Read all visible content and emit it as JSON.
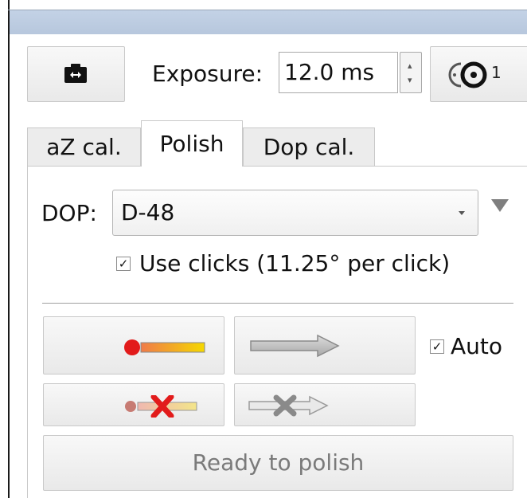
{
  "toolbar": {
    "camera_icon": "camera-swap-icon",
    "exposure_label": "Exposure:",
    "exposure_value": "12.0 ms",
    "channel_icon": "polarization-channel-icon",
    "channel_number": "1"
  },
  "tabs": [
    {
      "label": "aZ cal.",
      "selected": false
    },
    {
      "label": "Polish",
      "selected": true
    },
    {
      "label": "Dop cal.",
      "selected": false
    }
  ],
  "polish": {
    "dop_label": "DOP:",
    "dop_selected": "D-48",
    "use_clicks_checked": true,
    "use_clicks_label": "Use clicks (11.25° per click)",
    "auto_checked": true,
    "auto_label": "Auto",
    "status_button_label": "Ready to polish"
  },
  "colors": {
    "accent_red": "#e21b1b",
    "gradient_start": "#f07b4a",
    "gradient_end": "#f5d800",
    "titlebar": "#bccbe0"
  }
}
